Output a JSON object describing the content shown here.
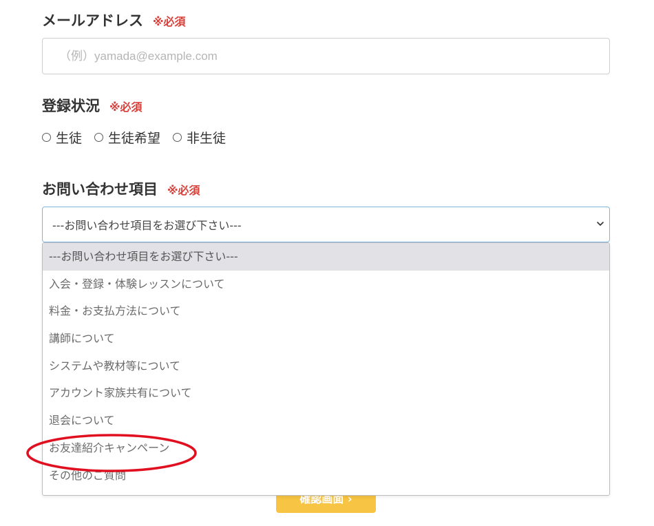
{
  "email": {
    "label": "メールアドレス",
    "required": "※必須",
    "placeholder": "（例）yamada@example.com",
    "value": ""
  },
  "status": {
    "label": "登録状況",
    "required": "※必須",
    "options": [
      "生徒",
      "生徒希望",
      "非生徒"
    ]
  },
  "inquiry": {
    "label": "お問い合わせ項目",
    "required": "※必須",
    "selected": "---お問い合わせ項目をお選び下さい---",
    "options": [
      "---お問い合わせ項目をお選び下さい---",
      "入会・登録・体験レッスンについて",
      "料金・お支払方法について",
      "講師について",
      "システムや教材等について",
      "アカウント家族共有について",
      "退会について",
      "お友達紹介キャンペーン",
      "その他のご質問"
    ]
  },
  "submit": {
    "label": "確認画面 ›"
  },
  "colors": {
    "required": "#d9413b",
    "submit": "#f7c443",
    "annotation": "#e01020",
    "select_border": "#7fb6e0"
  }
}
